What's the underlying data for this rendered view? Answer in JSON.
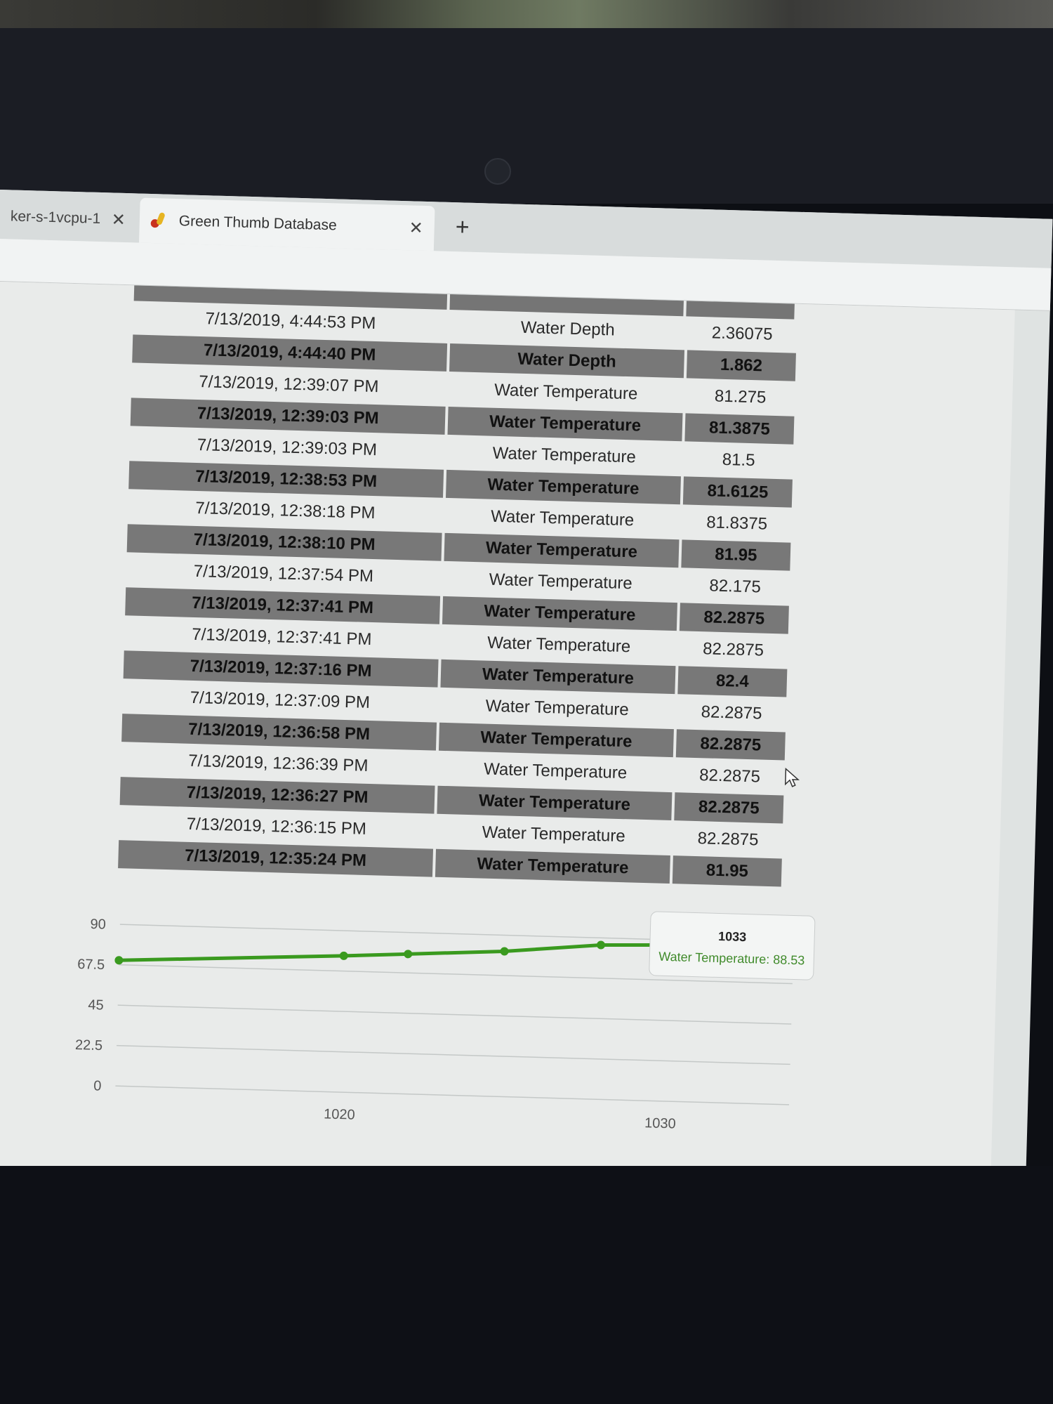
{
  "browser": {
    "tabs": [
      {
        "title": "ker-s-1vcpu-1",
        "close": "✕"
      },
      {
        "title": "Green Thumb Database",
        "close": "✕"
      }
    ],
    "new_tab": "+"
  },
  "table": {
    "rows": [
      {
        "timestamp": "7/13/2019, 4:44:53 PM",
        "type": "Water Depth",
        "value": "2.36075"
      },
      {
        "timestamp": "7/13/2019, 4:44:40 PM",
        "type": "Water Depth",
        "value": "1.862"
      },
      {
        "timestamp": "7/13/2019, 12:39:07 PM",
        "type": "Water Temperature",
        "value": "81.275"
      },
      {
        "timestamp": "7/13/2019, 12:39:03 PM",
        "type": "Water Temperature",
        "value": "81.3875"
      },
      {
        "timestamp": "7/13/2019, 12:39:03 PM",
        "type": "Water Temperature",
        "value": "81.5"
      },
      {
        "timestamp": "7/13/2019, 12:38:53 PM",
        "type": "Water Temperature",
        "value": "81.6125"
      },
      {
        "timestamp": "7/13/2019, 12:38:18 PM",
        "type": "Water Temperature",
        "value": "81.8375"
      },
      {
        "timestamp": "7/13/2019, 12:38:10 PM",
        "type": "Water Temperature",
        "value": "81.95"
      },
      {
        "timestamp": "7/13/2019, 12:37:54 PM",
        "type": "Water Temperature",
        "value": "82.175"
      },
      {
        "timestamp": "7/13/2019, 12:37:41 PM",
        "type": "Water Temperature",
        "value": "82.2875"
      },
      {
        "timestamp": "7/13/2019, 12:37:41 PM",
        "type": "Water Temperature",
        "value": "82.2875"
      },
      {
        "timestamp": "7/13/2019, 12:37:16 PM",
        "type": "Water Temperature",
        "value": "82.4"
      },
      {
        "timestamp": "7/13/2019, 12:37:09 PM",
        "type": "Water Temperature",
        "value": "82.2875"
      },
      {
        "timestamp": "7/13/2019, 12:36:58 PM",
        "type": "Water Temperature",
        "value": "82.2875"
      },
      {
        "timestamp": "7/13/2019, 12:36:39 PM",
        "type": "Water Temperature",
        "value": "82.2875"
      },
      {
        "timestamp": "7/13/2019, 12:36:27 PM",
        "type": "Water Temperature",
        "value": "82.2875"
      },
      {
        "timestamp": "7/13/2019, 12:36:15 PM",
        "type": "Water Temperature",
        "value": "82.2875"
      },
      {
        "timestamp": "7/13/2019, 12:35:24 PM",
        "type": "Water Temperature",
        "value": "81.95"
      }
    ]
  },
  "chart_data": {
    "type": "line",
    "series": [
      {
        "name": "Water Temperature",
        "x": [
          1013,
          1020,
          1022,
          1025,
          1028,
          1033
        ],
        "y": [
          70,
          76,
          78,
          81,
          86,
          88.53
        ]
      }
    ],
    "xlim": [
      1013,
      1034
    ],
    "ylim": [
      0,
      90
    ],
    "yticks": [
      "0",
      "22.5",
      "45",
      "67.5",
      "90"
    ],
    "xticks": [
      {
        "value": 1020,
        "label": "1020"
      },
      {
        "value": 1030,
        "label": "1030"
      }
    ],
    "grid": true,
    "line_color": "#3a9a1f",
    "tooltip": {
      "x_label": "1033",
      "text": "Water Temperature: 88.53"
    }
  }
}
